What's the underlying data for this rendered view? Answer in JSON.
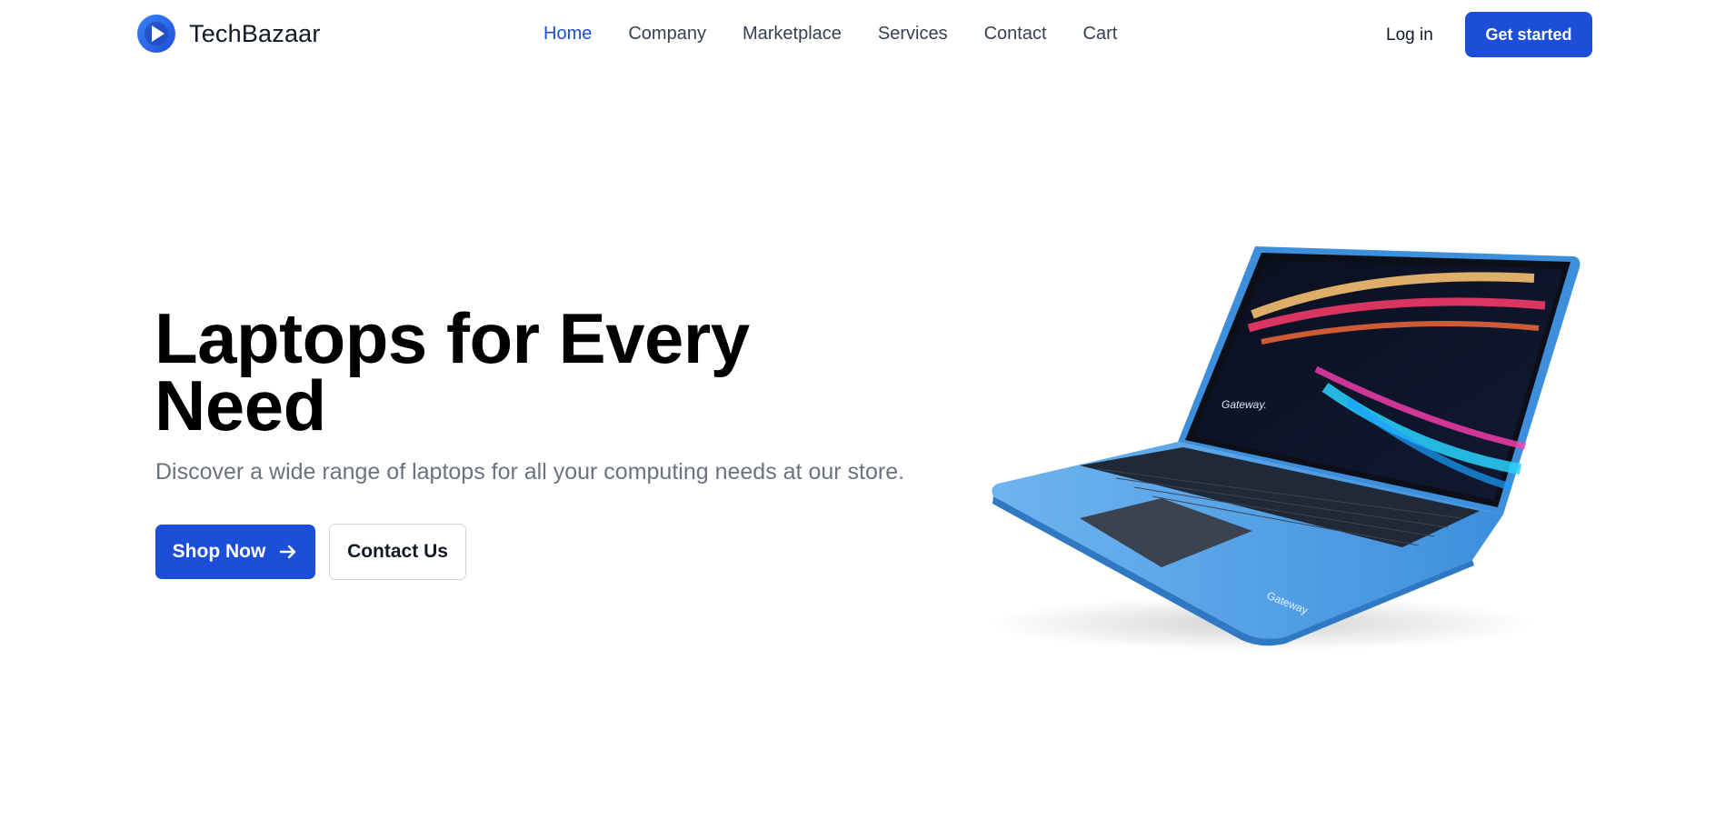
{
  "nav": {
    "brand": "TechBazaar",
    "links": [
      {
        "label": "Home",
        "active": true
      },
      {
        "label": "Company",
        "active": false
      },
      {
        "label": "Marketplace",
        "active": false
      },
      {
        "label": "Services",
        "active": false
      },
      {
        "label": "Contact",
        "active": false
      },
      {
        "label": "Cart",
        "active": false
      }
    ],
    "login_label": "Log in",
    "cta_label": "Get started"
  },
  "hero": {
    "title": "Laptops for Every Need",
    "subtitle": "Discover a wide range of laptops for all your computing needs at our store.",
    "primary_button": "Shop Now",
    "secondary_button": "Contact Us",
    "image_brand_screen": "Gateway.",
    "image_brand_body": "Gateway"
  },
  "colors": {
    "accent": "#1d4ed8",
    "laptop_body": "#4f9fe6",
    "subtitle": "#6b7280"
  },
  "icons": {
    "logo": "play-circle-icon",
    "shop_arrow": "arrow-right-icon"
  }
}
